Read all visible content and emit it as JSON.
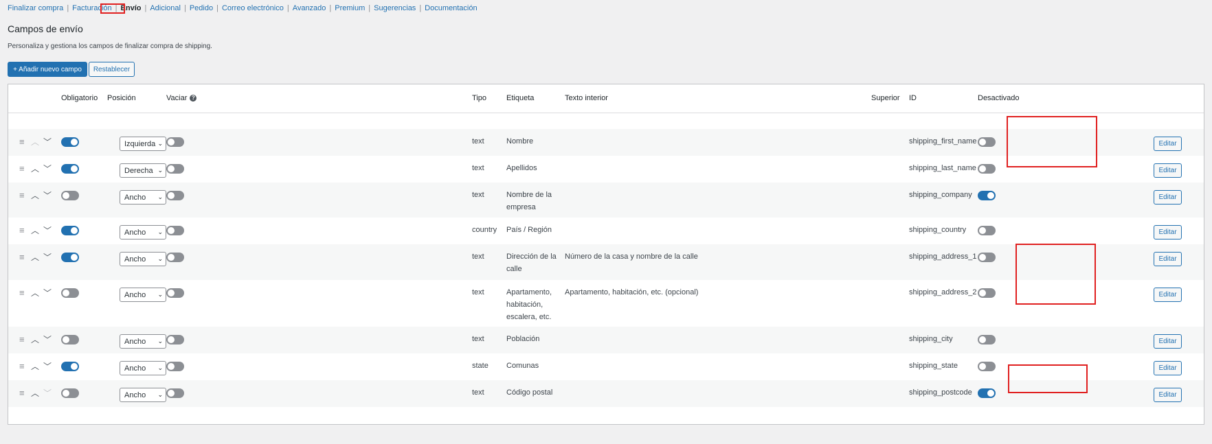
{
  "nav": [
    {
      "label": "Finalizar compra",
      "current": false
    },
    {
      "label": "Facturación",
      "current": false
    },
    {
      "label": "Envío",
      "current": true
    },
    {
      "label": "Adicional",
      "current": false
    },
    {
      "label": "Pedido",
      "current": false
    },
    {
      "label": "Correo electrónico",
      "current": false
    },
    {
      "label": "Avanzado",
      "current": false
    },
    {
      "label": "Premium",
      "current": false
    },
    {
      "label": "Sugerencias",
      "current": false
    },
    {
      "label": "Documentación",
      "current": false
    }
  ],
  "nav_separator": "|",
  "page": {
    "title": "Campos de envío",
    "description": "Personaliza y gestiona los campos de finalizar compra de shipping.",
    "add_button": "+ Añadir nuevo campo",
    "reset_button": "Restablecer"
  },
  "table": {
    "headers": {
      "required": "Obligatorio",
      "position": "Posición",
      "clear": "Vaciar",
      "type": "Tipo",
      "label": "Etiqueta",
      "placeholder": "Texto interior",
      "parent": "Superior",
      "id": "ID",
      "disabled": "Desactivado"
    },
    "help_icon": "question-circle-icon",
    "help_glyph": "?",
    "handle_glyph": "≡",
    "up_glyph": "︿",
    "down_glyph": "﹀",
    "select_chevron": "⌄",
    "edit_label": "Editar",
    "rows": [
      {
        "required": true,
        "position": "Izquierda",
        "clear": false,
        "type": "text",
        "label": "Nombre",
        "placeholder": "",
        "id": "shipping_first_name",
        "disabled": false,
        "up_enabled": false,
        "down_enabled": true
      },
      {
        "required": true,
        "position": "Derecha",
        "clear": false,
        "type": "text",
        "label": "Apellidos",
        "placeholder": "",
        "id": "shipping_last_name",
        "disabled": false,
        "up_enabled": true,
        "down_enabled": true
      },
      {
        "required": false,
        "position": "Ancho",
        "clear": false,
        "type": "text",
        "label": "Nombre de la empresa",
        "placeholder": "",
        "id": "shipping_company",
        "disabled": true,
        "up_enabled": true,
        "down_enabled": true
      },
      {
        "required": true,
        "position": "Ancho",
        "clear": false,
        "type": "country",
        "label": "País / Región",
        "placeholder": "",
        "id": "shipping_country",
        "disabled": false,
        "up_enabled": true,
        "down_enabled": true
      },
      {
        "required": true,
        "position": "Ancho",
        "clear": false,
        "type": "text",
        "label": "Dirección de la calle",
        "placeholder": "Número de la casa y nombre de la calle",
        "id": "shipping_address_1",
        "disabled": false,
        "up_enabled": true,
        "down_enabled": true
      },
      {
        "required": false,
        "position": "Ancho",
        "clear": false,
        "type": "text",
        "label": "Apartamento, habitación, escalera, etc.",
        "placeholder": "Apartamento, habitación, etc. (opcional)",
        "id": "shipping_address_2",
        "disabled": false,
        "up_enabled": true,
        "down_enabled": true
      },
      {
        "required": false,
        "position": "Ancho",
        "clear": false,
        "type": "text",
        "label": "Población",
        "placeholder": "",
        "id": "shipping_city",
        "disabled": false,
        "up_enabled": true,
        "down_enabled": true
      },
      {
        "required": true,
        "position": "Ancho",
        "clear": false,
        "type": "state",
        "label": "Comunas",
        "placeholder": "",
        "id": "shipping_state",
        "disabled": false,
        "up_enabled": true,
        "down_enabled": true
      },
      {
        "required": false,
        "position": "Ancho",
        "clear": false,
        "type": "text",
        "label": "Código postal",
        "placeholder": "",
        "id": "shipping_postcode",
        "disabled": true,
        "up_enabled": true,
        "down_enabled": false
      }
    ]
  },
  "colors": {
    "accent": "#2271b1",
    "highlight": "#e01f1f",
    "toggle_off": "#8c8f94"
  }
}
